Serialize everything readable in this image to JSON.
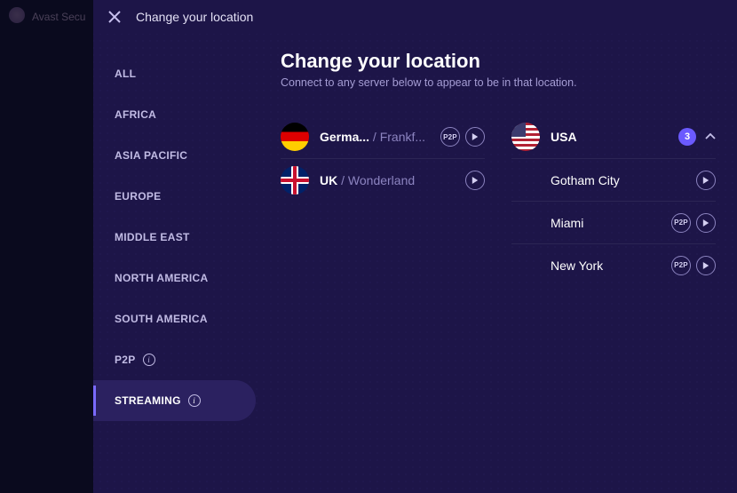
{
  "app_name": "Avast Secu",
  "panel": {
    "title": "Change your location"
  },
  "sidebar": {
    "items": [
      {
        "label": "ALL",
        "info": false
      },
      {
        "label": "AFRICA",
        "info": false
      },
      {
        "label": "ASIA PACIFIC",
        "info": false
      },
      {
        "label": "EUROPE",
        "info": false
      },
      {
        "label": "MIDDLE EAST",
        "info": false
      },
      {
        "label": "NORTH AMERICA",
        "info": false
      },
      {
        "label": "SOUTH AMERICA",
        "info": false
      },
      {
        "label": "P2P",
        "info": true
      },
      {
        "label": "STREAMING",
        "info": true
      }
    ],
    "active_index": 8
  },
  "content": {
    "title": "Change your location",
    "subtitle": "Connect to any server below to appear to be in that location."
  },
  "servers": {
    "left": [
      {
        "country": "Germa...",
        "city": "Frankf...",
        "flag": "de",
        "p2p": true
      },
      {
        "country": "UK",
        "city": "Wonderland",
        "flag": "uk",
        "p2p": false
      }
    ],
    "right": [
      {
        "country": "USA",
        "flag": "us",
        "count": "3",
        "expanded": true,
        "cities": [
          {
            "name": "Gotham City",
            "p2p": false
          },
          {
            "name": "Miami",
            "p2p": true
          },
          {
            "name": "New York",
            "p2p": true
          }
        ]
      }
    ]
  },
  "labels": {
    "p2p_badge": "P2P",
    "info_glyph": "i"
  }
}
